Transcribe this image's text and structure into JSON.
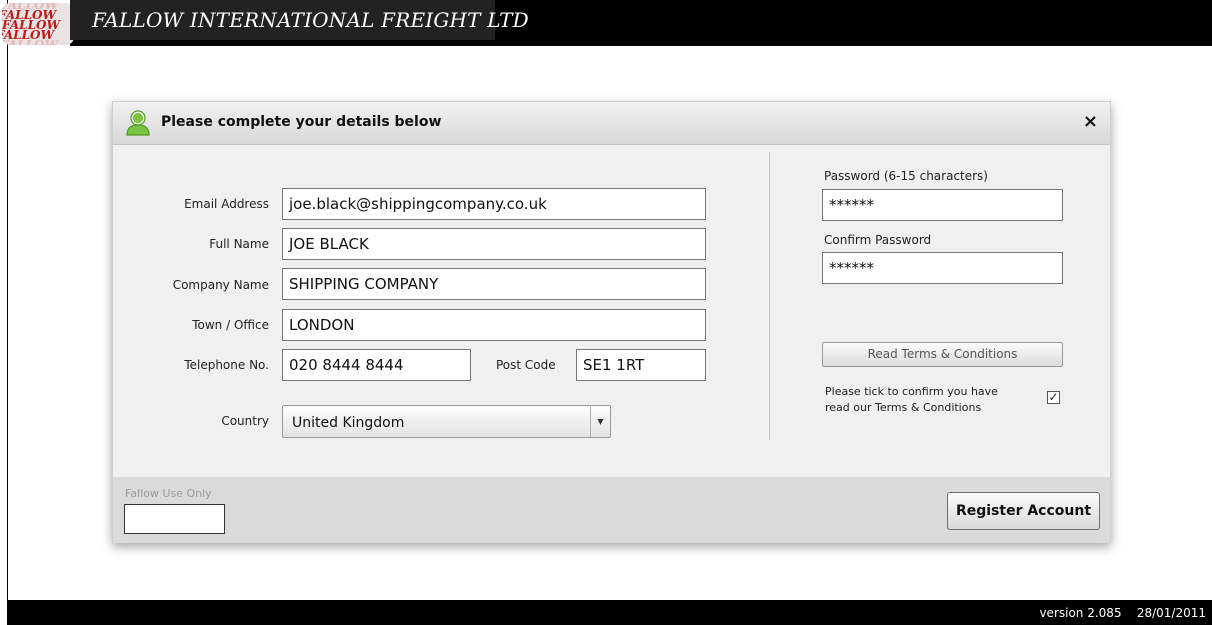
{
  "header": {
    "title": "FALLOW INTERNATIONAL FREIGHT LTD",
    "logo_text": "FALLOW"
  },
  "dialog": {
    "title": "Please complete your details below",
    "close": "×",
    "icons": {
      "title": "user-icon",
      "close": "close-icon"
    }
  },
  "form": {
    "email_label": "Email Address",
    "email_value": "joe.black@shippingcompany.co.uk",
    "fullname_label": "Full Name",
    "fullname_value": "JOE BLACK",
    "company_label": "Company Name",
    "company_value": "SHIPPING COMPANY",
    "town_label": "Town / Office",
    "town_value": "LONDON",
    "phone_label": "Telephone No.",
    "phone_value": "020 8444 8444",
    "postcode_label": "Post Code",
    "postcode_value": "SE1 1RT",
    "country_label": "Country",
    "country_value": "United Kingdom",
    "password_label": "Password  (6-15 characters)",
    "password_value": "******",
    "confirm_label": "Confirm Password",
    "confirm_value": "******",
    "terms_button": "Read Terms & Conditions",
    "terms_note_1": "Please tick to confirm you have",
    "terms_note_2": "read our Terms & Conditions",
    "terms_checked": "✓"
  },
  "bottom": {
    "fallow_label": "Fallow Use Only",
    "fallow_value": "",
    "register_button": "Register Account"
  },
  "footer": {
    "version": "version 2.085    28/01/2011"
  },
  "colors": {
    "header_bg": "#000000",
    "logo_red": "#c21717",
    "icon_green": "#6ab42d"
  }
}
